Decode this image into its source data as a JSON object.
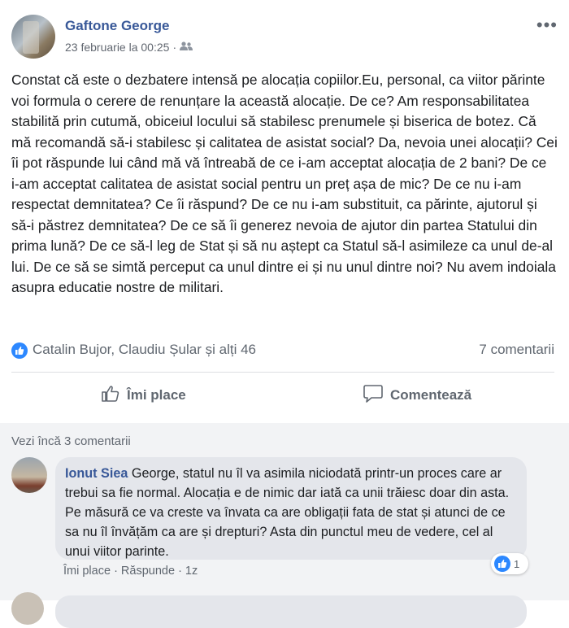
{
  "post": {
    "author": "Gaftone George",
    "date": "23 februarie la 00:25",
    "audience_icon": "friends-icon",
    "more_options": "•••",
    "text": "Constat că este o dezbatere intensă pe alocația copiilor.Eu, personal, ca viitor părinte voi formula o cerere de renunțare la această alocație. De ce? Am responsabilitatea stabilită prin cutumă, obiceiul locului să stabilesc prenumele și biserica de botez. Că mă recomandă să-i stabilesc și calitatea de asistat social? Da, nevoia unei alocații? Cei îi pot răspunde lui când mă vă întreabă de ce i-am acceptat alocația de 2 bani? De ce i-am acceptat calitatea de asistat social pentru un preț așa de mic? De ce nu i-am respectat demnitatea? Ce îi răspund? De ce nu i-am substituit, ca părinte, ajutorul și să-i păstrez demnitatea? De ce să îi generez nevoia de ajutor din partea Statului din prima lună? De ce să-l leg de Stat și să nu aștept ca Statul să-l asimileze ca unul de-al lui. De ce să se simtă perceput ca unul dintre ei și nu unul dintre noi? Nu avem indoiala asupra educatie nostre de militari."
  },
  "reactions": {
    "names": "Catalin Bujor, Claudiu Șular și alți 46",
    "comments_count": "7 comentarii"
  },
  "actions": {
    "like_label": "Îmi place",
    "comment_label": "Comentează"
  },
  "comments": {
    "more_label": "Vezi încă 3 comentarii",
    "items": [
      {
        "author": "Ionut Siea",
        "text": "George, statul nu îl va asimila niciodată printr-un proces care ar trebui sa fie normal. Alocația e de nimic dar iată ca unii trăiesc doar din asta. Pe măsură ce va creste va învata ca are obligații fata de stat și atunci de ce sa nu îl învățăm ca are și drepturi? Asta din punctul meu de vedere, cel al unui viitor parinte.",
        "like_label": "Îmi place",
        "reply_label": "Răspunde",
        "time": "1z",
        "reaction_count": "1"
      }
    ]
  },
  "colors": {
    "link_blue": "#385898",
    "like_blue": "#2d88ff",
    "secondary_text": "#606770"
  }
}
